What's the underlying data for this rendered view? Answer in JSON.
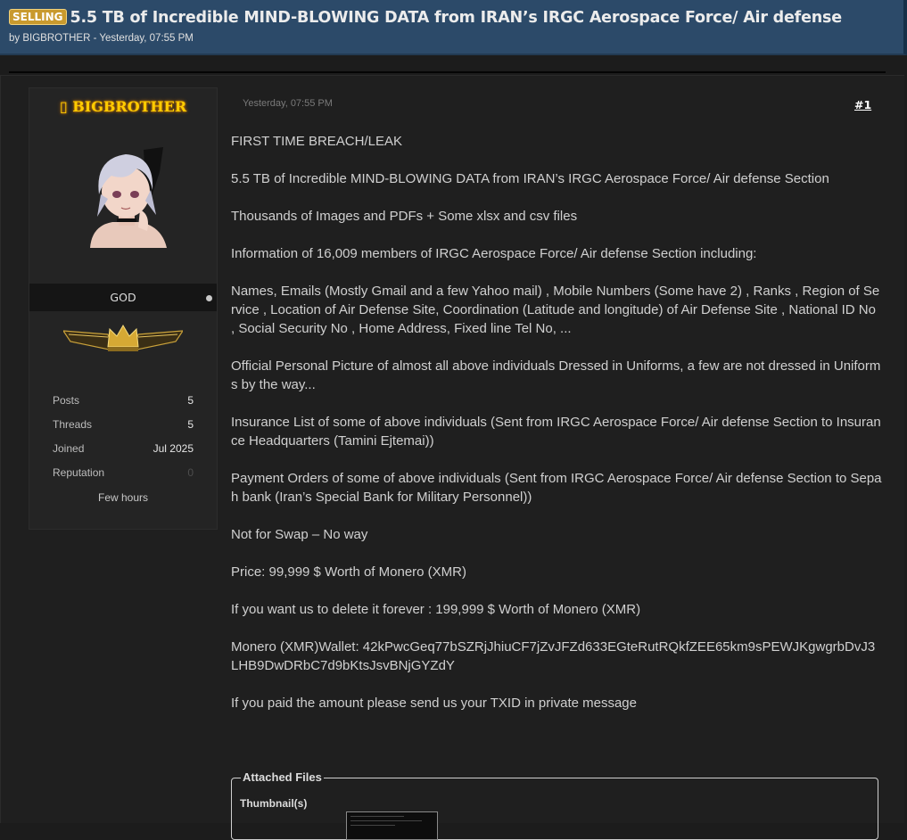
{
  "thread": {
    "prefix": "SELLING",
    "title": "5.5 TB of Incredible MIND-BLOWING  DATA from IRAN’s IRGC Aerospace Force/ Air defense",
    "byline": "by BIGBROTHER - Yesterday, 07:55 PM"
  },
  "author": {
    "username": "▯ BIGBROTHER",
    "rank": "GOD",
    "stats": [
      {
        "label": "Posts",
        "value": "5"
      },
      {
        "label": "Threads",
        "value": "5"
      },
      {
        "label": "Joined",
        "value": "Jul 2025"
      },
      {
        "label": "Reputation",
        "value": "0"
      }
    ],
    "last_active": "Few hours"
  },
  "post": {
    "date": "Yesterday, 07:55 PM",
    "number": "#1",
    "paragraphs": [
      "FIRST TIME BREACH/LEAK",
      "5.5 TB of Incredible MIND-BLOWING  DATA from IRAN’s IRGC Aerospace Force/ Air defense Section",
      "Thousands of Images and PDFs + Some xlsx and csv files",
      "Information of 16,009 members of IRGC Aerospace Force/ Air defense Section including:",
      "Names, Emails (Mostly Gmail and a few Yahoo mail) , Mobile Numbers (Some have 2) , Ranks , Region of Service , Location of Air Defense Site, Coordination (Latitude and longitude) of Air Defense Site , National ID No , Social Security No , Home Address, Fixed line Tel No, ...",
      "Official Personal Picture of almost all above individuals Dressed in Uniforms, a few are not dressed in Uniforms by the way...",
      "Insurance List of some of above individuals (Sent from IRGC Aerospace Force/ Air defense Section to Insurance Headquarters (Tamini Ejtemai))",
      "Payment Orders of some of above individuals (Sent from IRGC Aerospace Force/ Air defense Section to Sepah bank (Iran’s Special Bank for Military Personnel))",
      "Not for Swap – No way",
      "Price: 99,999 $ Worth of Monero (XMR)",
      "If you want us to delete it forever : 199,999 $ Worth of Monero (XMR)",
      "Monero (XMR)Wallet: 42kPwcGeq77bSZRjJhiuCF7jZvJFZd633EGteRutRQkfZEE65km9sPEWJKgwgrbDvJ3LHB9DwDRbC7d9bKtsJsvBNjGYZdY",
      "If you paid the amount please send us your TXID in private message"
    ]
  },
  "attachments": {
    "legend": "Attached Files",
    "thumbnails_label": "Thumbnail(s)"
  },
  "icons": {
    "avatar": "anime-avatar-image",
    "rank_badge": "gold-wings-crown-badge",
    "online": "status-dot-icon"
  },
  "colors": {
    "header_bg": "#2c4a69",
    "prefix_bg": "#c99a2e",
    "username": "#ffcc00",
    "page_bg": "#1f1f1f"
  }
}
